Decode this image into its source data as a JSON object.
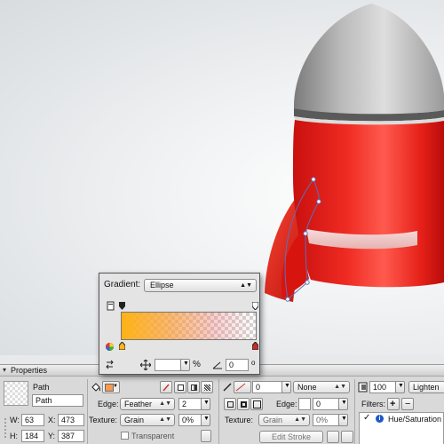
{
  "canvas": {
    "background": "#e4e6e8"
  },
  "gradient_popup": {
    "label": "Gradient:",
    "type_value": "Ellipse",
    "stop_colors": {
      "start": "#ffb41a",
      "end": "#f06478"
    },
    "angle_value": "0",
    "position_value": "",
    "percent_label": "%"
  },
  "properties": {
    "tab_title": "Properties",
    "object_type": "Path",
    "object_name": "Path",
    "w_label": "W:",
    "w_value": "63",
    "x_label": "X:",
    "x_value": "473",
    "h_label": "H:",
    "h_value": "184",
    "y_label": "Y:",
    "y_value": "387",
    "fill": {
      "color": "#f79a4e",
      "edge_label": "Edge:",
      "edge_value": "Feather",
      "edge_amount": "2",
      "texture_label": "Texture:",
      "texture_value": "Grain",
      "texture_amount": "0%",
      "transparent_label": "Transparent"
    },
    "stroke": {
      "size": "0",
      "style": "None",
      "edge_label": "Edge:",
      "edge_value": "0",
      "texture_label": "Texture:",
      "texture_value": "Grain",
      "texture_amount": "0%",
      "edit_stroke_label": "Edit Stroke"
    },
    "effects": {
      "opacity": "100",
      "blend_mode": "Lighten",
      "filters_label": "Filters:",
      "filter_item": "Hue/Saturation"
    }
  }
}
